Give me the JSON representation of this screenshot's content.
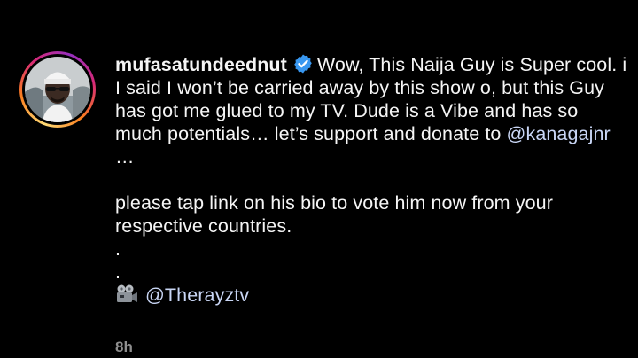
{
  "comment": {
    "username": "mufasatundeednut",
    "paragraph1_part1": "Wow, This Naija Guy is Super cool. i I said I won’t be carried away by this show o, but this Guy has got me glued to my TV. Dude is a Vibe and has so much potentials… let’s support and donate to ",
    "mention1": "@kanagajnr",
    "paragraph1_part2": " …",
    "paragraph2": "please tap link on his bio to vote him now from your respective countries.",
    "dot1": ".",
    "dot2": ".",
    "mention2": "@Therayztv",
    "camera_icon": "movie-camera-icon",
    "verified_icon": "verified-badge-icon"
  },
  "meta": {
    "time_ago": "8h"
  },
  "colors": {
    "background": "#000000",
    "text": "#f5f5f5",
    "mention": "#c9d6f5",
    "verified": "#3897f0",
    "meta": "#8e8e8e"
  }
}
